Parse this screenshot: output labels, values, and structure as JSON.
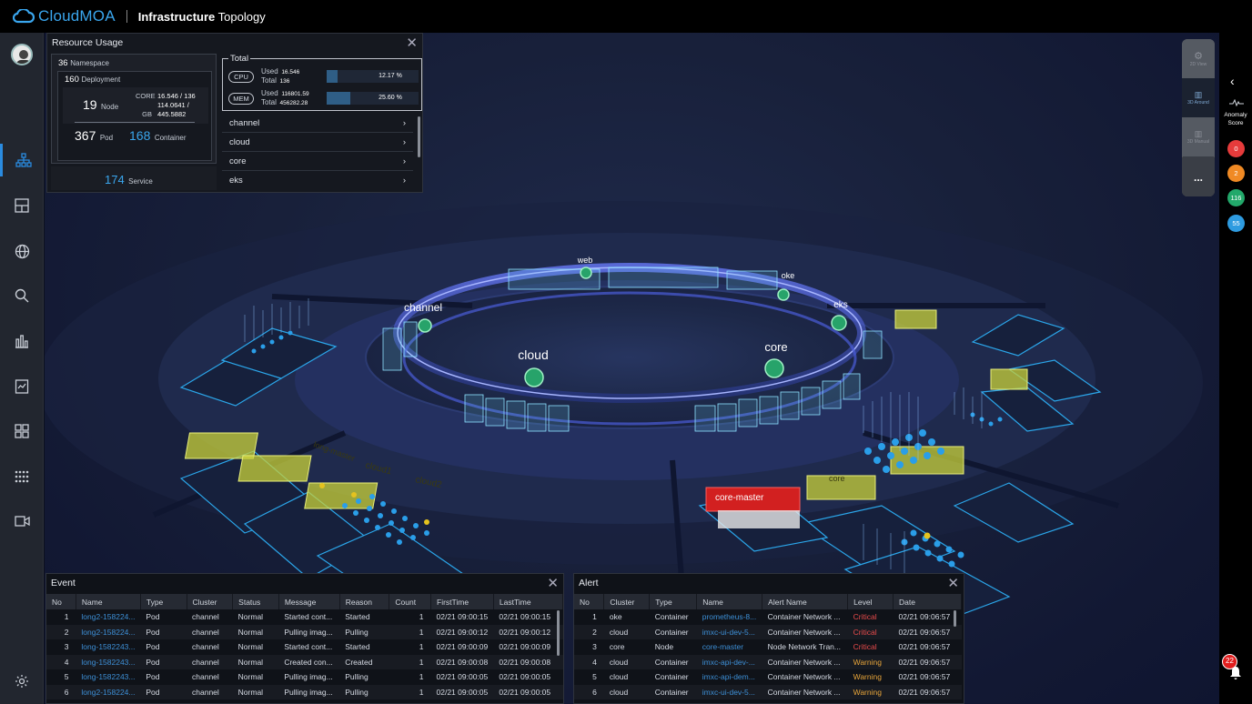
{
  "app": {
    "brand": "CloudMOA",
    "title_bold": "Infrastructure",
    "title_rest": " Topology"
  },
  "sidebar": {
    "items": [
      "topology",
      "dashboard",
      "globe",
      "search",
      "chart",
      "report",
      "apps",
      "grid",
      "video",
      "settings"
    ]
  },
  "resource_usage": {
    "title": "Resource Usage",
    "namespace": {
      "value": "36",
      "label": "Namespace"
    },
    "deployment": {
      "value": "160",
      "label": "Deployment"
    },
    "node": {
      "value": "19",
      "label": "Node"
    },
    "core": {
      "label": "CORE",
      "value": "16.546 / 136"
    },
    "gb": {
      "label": "GB",
      "value1": "114.0641 /",
      "value2": "445.5882"
    },
    "pod": {
      "value": "367",
      "label": "Pod"
    },
    "container": {
      "value": "168",
      "label": "Container"
    },
    "service": {
      "value": "174",
      "label": "Service"
    },
    "total": {
      "label": "Total",
      "cpu": {
        "label": "CPU",
        "used_label": "Used",
        "used": "16.546",
        "total_label": "Total",
        "total": "136",
        "percent_text": "12.17 %",
        "percent": 12.17
      },
      "mem": {
        "label": "MEM",
        "used_label": "Used",
        "used": "116801.59",
        "total_label": "Total",
        "total": "456282.28",
        "percent_text": "25.60 %",
        "percent": 25.6
      }
    },
    "namespaces": [
      "channel",
      "cloud",
      "core",
      "eks"
    ]
  },
  "topology_labels": {
    "web": "web",
    "oke": "oke",
    "eks": "eks",
    "channel": "channel",
    "cloud": "cloud",
    "core": "core",
    "long_master": "long-master",
    "cloud1": "cloud1",
    "cloud2": "cloud2",
    "core_master": "core-master",
    "core_short": "core"
  },
  "view_modes": {
    "view2d": "2D View",
    "around3d": "3D Around",
    "manual3d": "3D Manual",
    "more": "..."
  },
  "anomaly": {
    "label_line1": "Anomaly",
    "label_line2": "Score",
    "scores": [
      "0",
      "2",
      "116",
      "55"
    ],
    "colors": [
      "#e63b3b",
      "#f08a24",
      "#22a86a",
      "#2e9be0"
    ]
  },
  "notifications": {
    "count": "22"
  },
  "event": {
    "title": "Event",
    "columns": [
      "No",
      "Name",
      "Type",
      "Cluster",
      "Status",
      "Message",
      "Reason",
      "Count",
      "FirstTime",
      "LastTime"
    ],
    "rows": [
      [
        "1",
        "long2-158224...",
        "Pod",
        "channel",
        "Normal",
        "Started cont...",
        "Started",
        "1",
        "02/21 09:00:15",
        "02/21 09:00:15"
      ],
      [
        "2",
        "long2-158224...",
        "Pod",
        "channel",
        "Normal",
        "Pulling imag...",
        "Pulling",
        "1",
        "02/21 09:00:12",
        "02/21 09:00:12"
      ],
      [
        "3",
        "long-1582243...",
        "Pod",
        "channel",
        "Normal",
        "Started cont...",
        "Started",
        "1",
        "02/21 09:00:09",
        "02/21 09:00:09"
      ],
      [
        "4",
        "long-1582243...",
        "Pod",
        "channel",
        "Normal",
        "Created con...",
        "Created",
        "1",
        "02/21 09:00:08",
        "02/21 09:00:08"
      ],
      [
        "5",
        "long-1582243...",
        "Pod",
        "channel",
        "Normal",
        "Pulling imag...",
        "Pulling",
        "1",
        "02/21 09:00:05",
        "02/21 09:00:05"
      ],
      [
        "6",
        "long2-158224...",
        "Pod",
        "channel",
        "Normal",
        "Pulling imag...",
        "Pulling",
        "1",
        "02/21 09:00:05",
        "02/21 09:00:05"
      ]
    ]
  },
  "alert": {
    "title": "Alert",
    "columns": [
      "No",
      "Cluster",
      "Type",
      "Name",
      "Alert Name",
      "Level",
      "Date"
    ],
    "rows": [
      [
        "1",
        "oke",
        "Container",
        "prometheus-8...",
        "Container Network ...",
        "Critical",
        "02/21 09:06:57"
      ],
      [
        "2",
        "cloud",
        "Container",
        "imxc-ui-dev-5...",
        "Container Network ...",
        "Critical",
        "02/21 09:06:57"
      ],
      [
        "3",
        "core",
        "Node",
        "core-master",
        "Node Network Tran...",
        "Critical",
        "02/21 09:06:57"
      ],
      [
        "4",
        "cloud",
        "Container",
        "imxc-api-dev-...",
        "Container Network ...",
        "Warning",
        "02/21 09:06:57"
      ],
      [
        "5",
        "cloud",
        "Container",
        "imxc-api-dem...",
        "Container Network ...",
        "Warning",
        "02/21 09:06:57"
      ],
      [
        "6",
        "cloud",
        "Container",
        "imxc-ui-dev-5...",
        "Container Network ...",
        "Warning",
        "02/21 09:06:57"
      ]
    ]
  }
}
